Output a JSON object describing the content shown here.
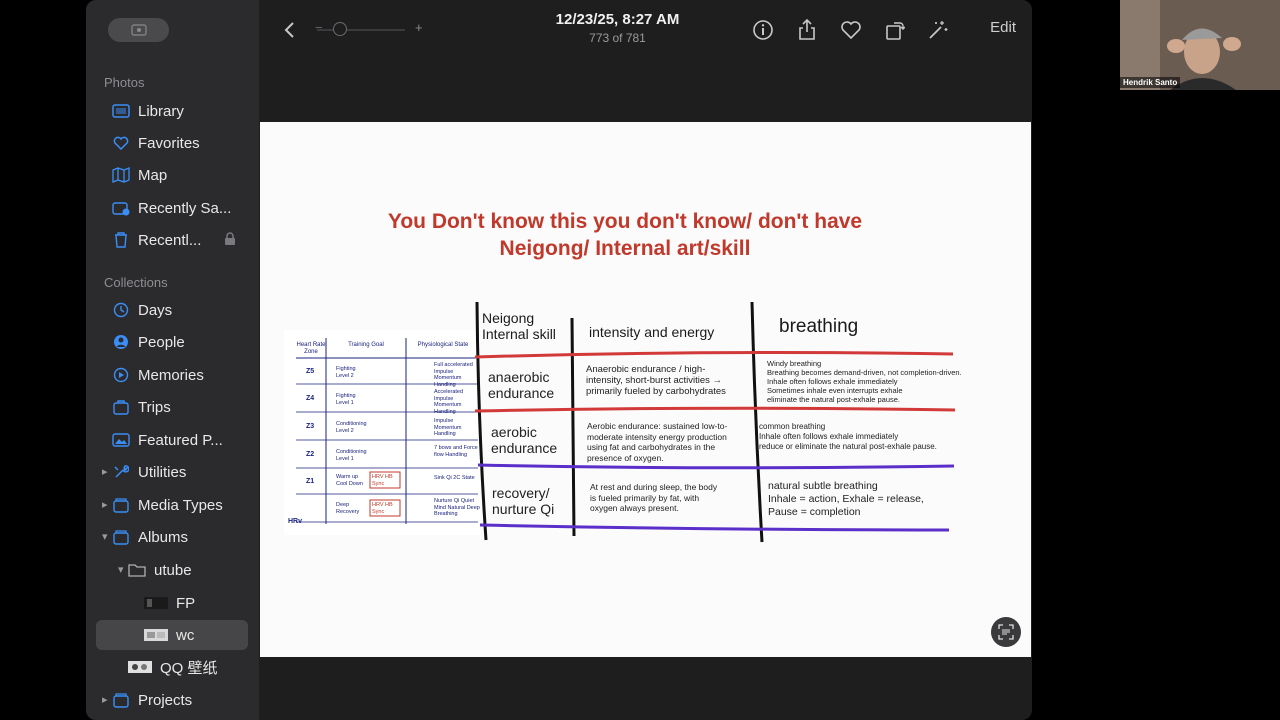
{
  "sidebar": {
    "section_photos": "Photos",
    "section_collections": "Collections",
    "items": [
      {
        "label": "Library"
      },
      {
        "label": "Favorites"
      },
      {
        "label": "Map"
      },
      {
        "label": "Recently Sa..."
      },
      {
        "label": "Recentl..."
      },
      {
        "label": "Days"
      },
      {
        "label": "People"
      },
      {
        "label": "Memories"
      },
      {
        "label": "Trips"
      },
      {
        "label": "Featured P..."
      },
      {
        "label": "Utilities"
      },
      {
        "label": "Media Types"
      },
      {
        "label": "Albums"
      },
      {
        "label": "utube"
      },
      {
        "label": "FP"
      },
      {
        "label": "wc"
      },
      {
        "label": "QQ 壁纸"
      },
      {
        "label": "Projects"
      }
    ]
  },
  "toolbar": {
    "date": "12/23/25, 8:27 AM",
    "count": "773 of 781",
    "edit_label": "Edit",
    "zoom_minus": "−",
    "zoom_plus": "+"
  },
  "slide": {
    "title_line1": "You Don't know this you don't know/ don't have",
    "title_line2": "Neigong/ Internal art/skill",
    "col_headers": {
      "neigong_1": "Neigong",
      "neigong_2": "Internal skill",
      "intensity": "intensity and energy",
      "breathing": "breathing"
    },
    "rows": [
      {
        "skill_1": "anaerobic",
        "skill_2": "endurance",
        "intensity": [
          "Anaerobic endurance / high-",
          "intensity, short-burst activities →",
          "primarily fueled by carbohydrates"
        ],
        "breathing": [
          "Windy breathing",
          "Breathing becomes demand-driven, not completion-driven.",
          "Inhale often follows exhale immediately",
          "Sometimes inhale even interrupts exhale",
          "eliminate the natural post-exhale pause."
        ]
      },
      {
        "skill_1": "aerobic",
        "skill_2": "endurance",
        "intensity": [
          "Aerobic endurance: sustained low-to-",
          "moderate intensity energy production",
          "using fat and carbohydrates in the",
          "presence of oxygen."
        ],
        "breathing": [
          "common breathing",
          "Inhale often follows exhale immediately",
          "reduce or eliminate the natural post-exhale pause."
        ]
      },
      {
        "skill_1": "recovery/",
        "skill_2": "nurture Qi",
        "intensity": [
          "At rest and during sleep, the body",
          "is fueled primarily by fat, with",
          "oxygen always present."
        ],
        "breathing": [
          "natural subtle breathing",
          "Inhale = action, Exhale = release,",
          "Pause = completion"
        ]
      }
    ],
    "mini_table": {
      "headers": [
        "Heart Rate Zone",
        "Training Goal",
        "Physiological State"
      ],
      "zones": [
        {
          "z": "Z5",
          "goal": "Fighting Level 2",
          "state": "Full accelerated Impulse Momentum Handling"
        },
        {
          "z": "Z4",
          "goal": "Fighting Level 1",
          "state": "Accelerated Impulse Momentum Handling"
        },
        {
          "z": "Z3",
          "goal": "Conditioning Level 2",
          "state": "Impulse Momentum Handling"
        },
        {
          "z": "Z2",
          "goal": "Conditioning Level 1",
          "state": "7 bows and Force flow Handling"
        },
        {
          "z": "Z1",
          "goal": "Warm up Cool Down",
          "tag": "HRV HB Sync",
          "state": "Sink Qi 2C State"
        },
        {
          "z": "",
          "goal": "Deep Recovery",
          "tag": "HRV HB Sync",
          "state": "Nurture Qi Quiet Mind Natural Deep Breathing"
        }
      ],
      "footer": "HRv"
    }
  },
  "video": {
    "name": "Hendrik Santo"
  }
}
